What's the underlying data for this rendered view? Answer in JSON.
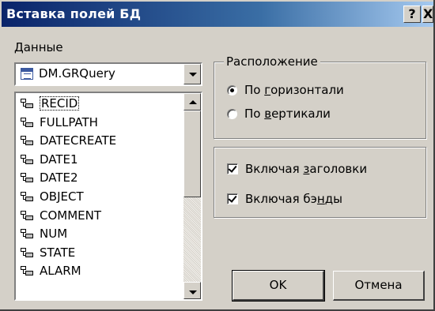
{
  "window": {
    "title": "Вставка полей БД",
    "help_label": "?",
    "close_label": "X"
  },
  "data_section": {
    "label_prefix": "Д",
    "label_rest": "анные",
    "selected_dataset": "DM.GRQuery",
    "fields": [
      "RECID",
      "FULLPATH",
      "DATECREATE",
      "DATE1",
      "DATE2",
      "OBJECT",
      "COMMENT",
      "NUM",
      "STATE",
      "ALARM"
    ],
    "selected_field": "RECID"
  },
  "placement": {
    "legend": "Расположение",
    "horizontal": {
      "pre": "По ",
      "accel": "г",
      "post": "оризонтали",
      "checked": true
    },
    "vertical": {
      "pre": "По ",
      "accel": "в",
      "post": "ертикали",
      "checked": false
    }
  },
  "options": {
    "include_headers": {
      "pre": "Включая ",
      "accel": "з",
      "post": "аголовки",
      "checked": true
    },
    "include_bands": {
      "pre": "Включая бэ",
      "accel": "н",
      "post": "ды",
      "checked": true
    }
  },
  "buttons": {
    "ok": "OK",
    "cancel": "Отмена"
  }
}
